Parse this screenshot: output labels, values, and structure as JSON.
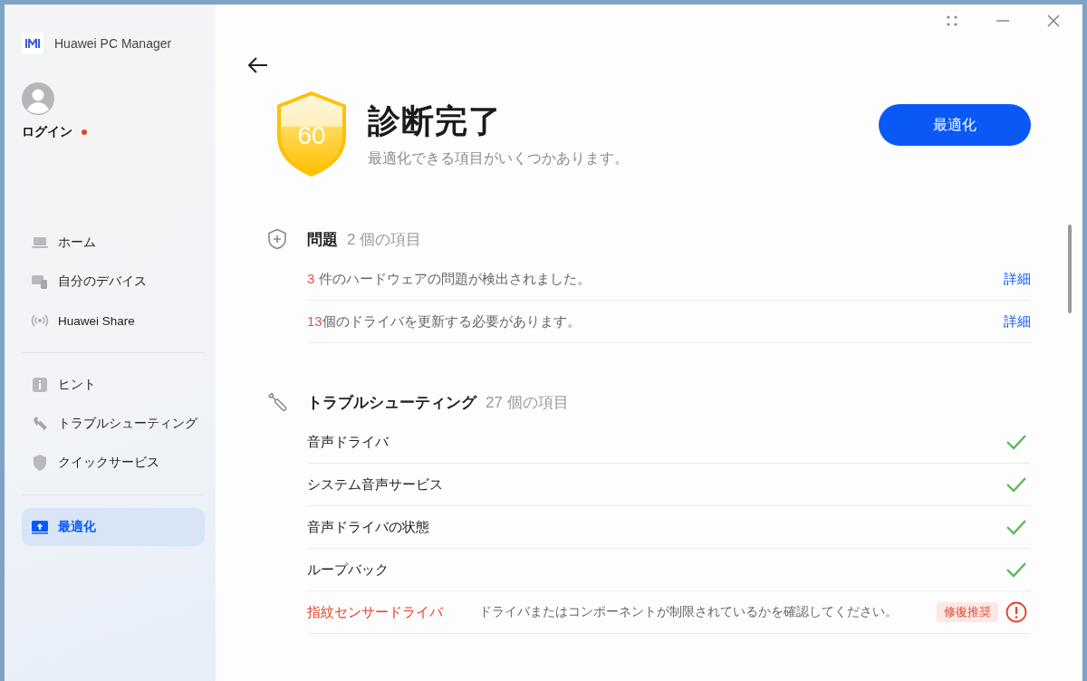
{
  "app": {
    "name": "Huawei PC Manager"
  },
  "account": {
    "label": "ログイン",
    "notification_dot": true
  },
  "nav_groups": [
    [
      {
        "label": "ホーム",
        "selected": false
      },
      {
        "label": "自分のデバイス",
        "selected": false
      },
      {
        "label": "Huawei Share",
        "selected": false
      }
    ],
    [
      {
        "label": "ヒント",
        "selected": false
      },
      {
        "label": "トラブルシューティング",
        "selected": false
      },
      {
        "label": "クイックサービス",
        "selected": false
      }
    ],
    [
      {
        "label": "最適化",
        "selected": true
      }
    ]
  ],
  "result": {
    "score": "60",
    "title": "診断完了",
    "subtitle": "最適化できる項目がいくつかあります。",
    "button": "最適化"
  },
  "sections": [
    {
      "title": "問題",
      "count": "2 個の項目",
      "kind": "issues",
      "rows": [
        {
          "count": "3",
          "text": " 件のハードウェアの問題が検出されました。",
          "link": "詳細"
        },
        {
          "count": "13",
          "text": "個のドライバを更新する必要があります。",
          "link": "詳細"
        }
      ]
    },
    {
      "title": "トラブルシューティング",
      "count": "27 個の項目",
      "kind": "checks",
      "rows": [
        {
          "name": "音声ドライバ",
          "kind": "ok"
        },
        {
          "name": "システム音声サービス",
          "kind": "ok"
        },
        {
          "name": "音声ドライバの状態",
          "kind": "ok"
        },
        {
          "name": "ループバック",
          "kind": "ok"
        },
        {
          "name": "指紋センサードライバ",
          "kind": "warning",
          "description": "ドライバまたはコンポーネントが制限されているかを確認してください。",
          "badge": "修復推奨"
        }
      ]
    }
  ]
}
